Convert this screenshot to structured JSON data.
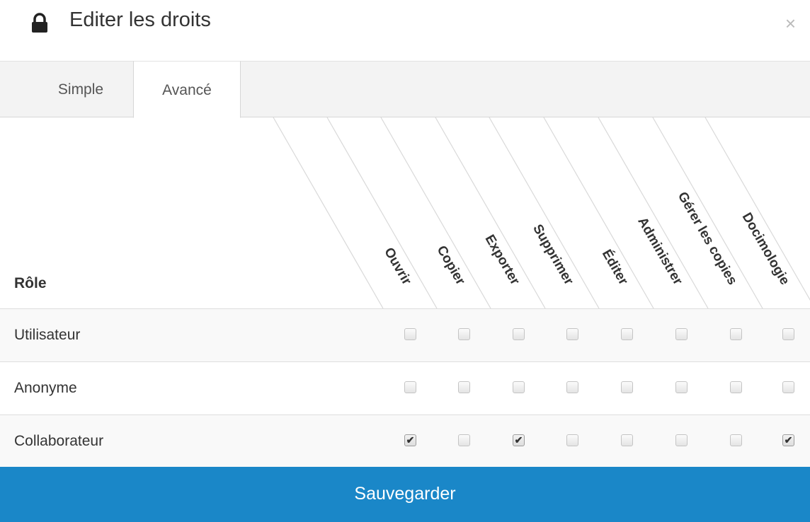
{
  "dialog": {
    "title": "Editer les droits",
    "close_label": "×"
  },
  "tabs": [
    {
      "label": "Simple",
      "active": false
    },
    {
      "label": "Avancé",
      "active": true
    }
  ],
  "table": {
    "role_header": "Rôle",
    "permissions": [
      "Ouvrir",
      "Copier",
      "Exporter",
      "Supprimer",
      "Éditer",
      "Administrer",
      "Gérer les copies",
      "Docimologie"
    ],
    "rows": [
      {
        "role": "Utilisateur",
        "checked": [
          false,
          false,
          false,
          false,
          false,
          false,
          false,
          false
        ]
      },
      {
        "role": "Anonyme",
        "checked": [
          false,
          false,
          false,
          false,
          false,
          false,
          false,
          false
        ]
      },
      {
        "role": "Collaborateur",
        "checked": [
          true,
          false,
          true,
          false,
          false,
          false,
          false,
          true
        ]
      }
    ]
  },
  "actions": {
    "save_label": "Sauvegarder"
  },
  "colors": {
    "primary": "#1a87c8",
    "tab_bar": "#f3f3f3"
  },
  "icons": {
    "title_icon": "lock-icon",
    "close_icon": "close-icon"
  }
}
